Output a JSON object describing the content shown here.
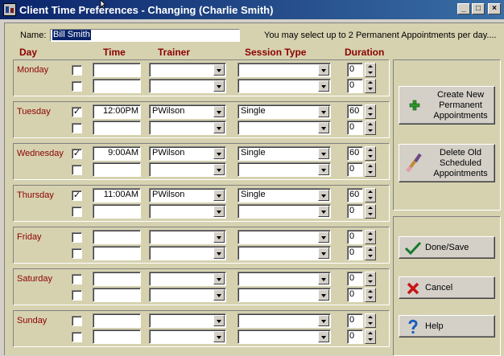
{
  "window": {
    "title": "Client Time Preferences - Changing  (Charlie Smith)",
    "minimize": "_",
    "maximize": "□",
    "close": "×"
  },
  "form": {
    "name_label": "Name:",
    "name_value": "Bill Smith",
    "info": "You may select up to 2 Permanent Appointments per day...."
  },
  "columns": {
    "day": "Day",
    "time": "Time",
    "trainer": "Trainer",
    "session": "Session Type",
    "duration": "Duration"
  },
  "days": [
    {
      "label": "Monday",
      "rows": [
        {
          "checked": false,
          "time": "",
          "trainer": "",
          "session": "",
          "duration": "0"
        },
        {
          "checked": false,
          "time": "",
          "trainer": "",
          "session": "",
          "duration": "0"
        }
      ]
    },
    {
      "label": "Tuesday",
      "rows": [
        {
          "checked": true,
          "time": "12:00PM",
          "trainer": "PWilson",
          "session": "Single",
          "duration": "60"
        },
        {
          "checked": false,
          "time": "",
          "trainer": "",
          "session": "",
          "duration": "0"
        }
      ]
    },
    {
      "label": "Wednesday",
      "rows": [
        {
          "checked": true,
          "time": "9:00AM",
          "trainer": "PWilson",
          "session": "Single",
          "duration": "60"
        },
        {
          "checked": false,
          "time": "",
          "trainer": "",
          "session": "",
          "duration": "0"
        }
      ]
    },
    {
      "label": "Thursday",
      "rows": [
        {
          "checked": true,
          "time": "11:00AM",
          "trainer": "PWilson",
          "session": "Single",
          "duration": "60"
        },
        {
          "checked": false,
          "time": "",
          "trainer": "",
          "session": "",
          "duration": "0"
        }
      ]
    },
    {
      "label": "Friday",
      "rows": [
        {
          "checked": false,
          "time": "",
          "trainer": "",
          "session": "",
          "duration": "0"
        },
        {
          "checked": false,
          "time": "",
          "trainer": "",
          "session": "",
          "duration": "0"
        }
      ]
    },
    {
      "label": "Saturday",
      "rows": [
        {
          "checked": false,
          "time": "",
          "trainer": "",
          "session": "",
          "duration": "0"
        },
        {
          "checked": false,
          "time": "",
          "trainer": "",
          "session": "",
          "duration": "0"
        }
      ]
    },
    {
      "label": "Sunday",
      "rows": [
        {
          "checked": false,
          "time": "",
          "trainer": "",
          "session": "",
          "duration": "0"
        },
        {
          "checked": false,
          "time": "",
          "trainer": "",
          "session": "",
          "duration": "0"
        }
      ]
    }
  ],
  "buttons": {
    "create": "Create New\nPermanent\nAppointments",
    "delete": "Delete Old\nScheduled\nAppointments",
    "done": "Done/Save",
    "cancel": "Cancel",
    "help": "Help"
  },
  "icons": {
    "create": "plus-icon",
    "delete": "eraser-icon",
    "done": "checkmark-icon",
    "cancel": "x-icon",
    "help": "question-icon"
  },
  "colors": {
    "titlebar": "#0a246a",
    "panel": "#d6d2b0",
    "accent_label": "#8b0000",
    "selection": "#0a246a"
  }
}
